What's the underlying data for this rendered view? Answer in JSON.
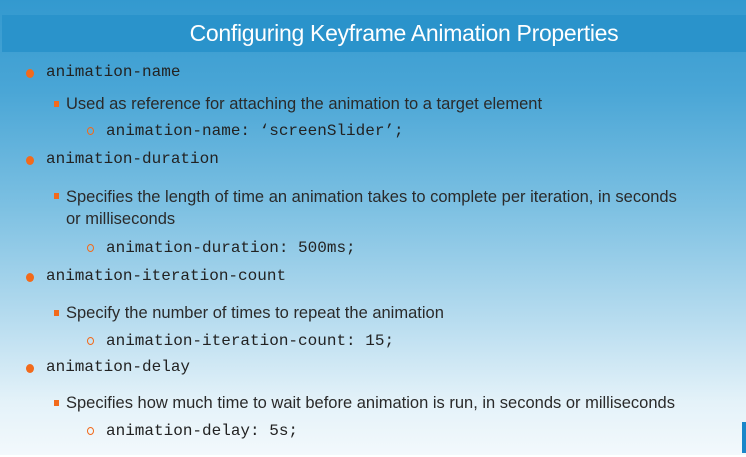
{
  "title": "Configuring Keyframe Animation Properties",
  "items": [
    {
      "property": "animation-name",
      "description": "Used as reference for attaching the animation to a target element",
      "example": "animation-name: ‘screenSlider’;"
    },
    {
      "property": "animation-duration",
      "description": "Specifies the length of time an animation takes to complete per iteration, in seconds or milliseconds",
      "example": "animation-duration: 500ms;"
    },
    {
      "property": "animation-iteration-count",
      "description": "Specify the number of times to repeat the animation",
      "example": "animation-iteration-count: 15;"
    },
    {
      "property": "animation-delay",
      "description": "Specifies how much time to wait before animation is run, in seconds or milliseconds",
      "example": "animation-delay: 5s;"
    }
  ]
}
